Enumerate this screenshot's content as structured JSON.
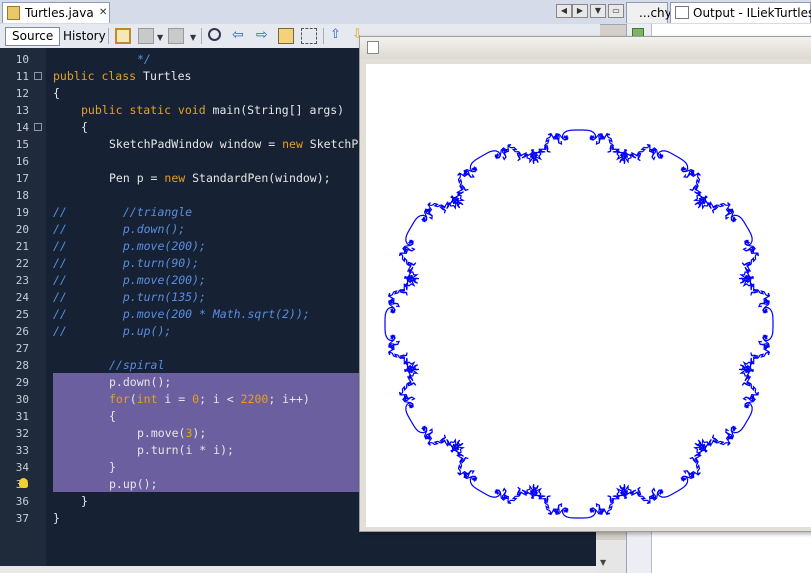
{
  "editor_tab": {
    "filename": "Turtles.java",
    "close": "✕"
  },
  "output_tabs": {
    "tab1_label": "...chy",
    "tab2_label": "Output - ILiekTurtles ("
  },
  "toolbar": {
    "source_label": "Source",
    "history_label": "History"
  },
  "gutter": {
    "lines": [
      "10",
      "11",
      "12",
      "13",
      "14",
      "15",
      "16",
      "17",
      "18",
      "19",
      "20",
      "21",
      "22",
      "23",
      "24",
      "25",
      "26",
      "27",
      "28",
      "29",
      "30",
      "31",
      "32",
      "33",
      "34",
      "35",
      "36",
      "37"
    ]
  },
  "code": {
    "l10": "*/",
    "l11_kw": "public class",
    "l11_rest": " Turtles",
    "l12": "{",
    "l13_kw": "public static void",
    "l13_rest": " main(String[] args)",
    "l14": "{",
    "l15_a": "SketchPadWindow window = ",
    "l15_kw": "new",
    "l15_b": " SketchP",
    "l17_a": "Pen p = ",
    "l17_kw": "new",
    "l17_b": " StandardPen(window);",
    "l19_sl": "//",
    "l19_c": "//triangle",
    "l20_c": "p.down();",
    "l21_c": "p.move(200);",
    "l22_c": "p.turn(90);",
    "l23_c": "p.move(200);",
    "l24_c": "p.turn(135);",
    "l25_c": "p.move(200 * Math.sqrt(2));",
    "l26_c": "p.up();",
    "l28_c": "//spiral",
    "l29": "p.down();",
    "l30_kw": "for",
    "l30_a": "(",
    "l30_kw2": "int",
    "l30_b": " i = ",
    "l30_n1": "0",
    "l30_c": "; i < ",
    "l30_n2": "2200",
    "l30_d": "; i++)",
    "l31": "{",
    "l32_a": "p.move(",
    "l32_n": "3",
    "l32_b": ");",
    "l33": "p.turn(i * i);",
    "l34": "}",
    "l35": "p.up();",
    "l36": "}",
    "l37": "}"
  },
  "colors": {
    "editor_bg": "#162234",
    "selection": "#6b5fa0",
    "keyword": "#e6a01e",
    "comment": "#5a8de0",
    "turtle_line": "#0000ff"
  }
}
